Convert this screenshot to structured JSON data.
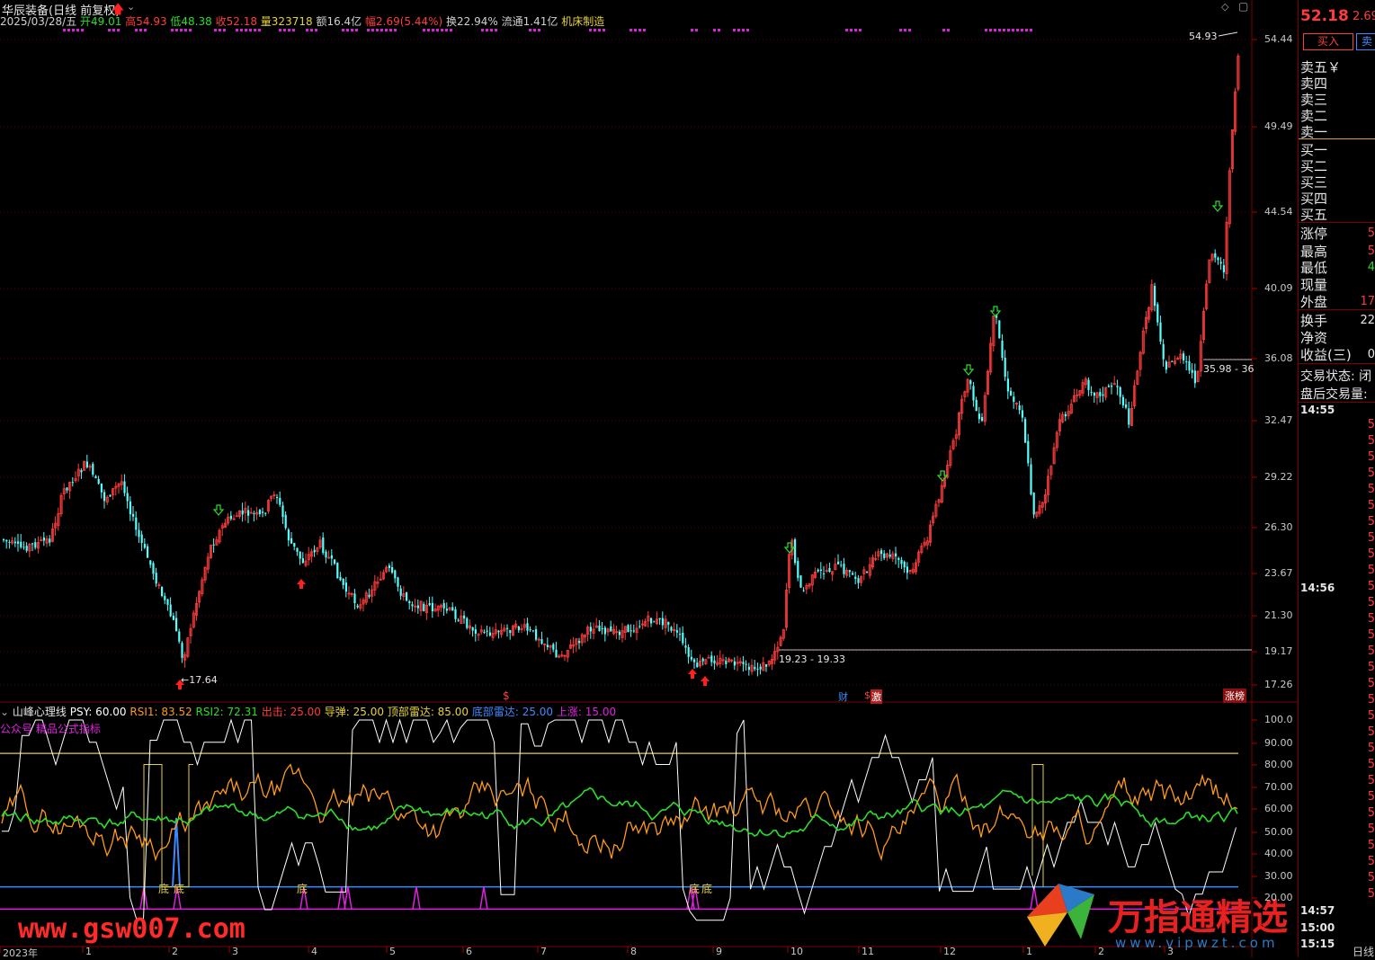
{
  "header": {
    "stock": "华辰装备(日线 前复权)",
    "date": "2025/03/28/五",
    "open": "开49.01",
    "high": "高54.93",
    "low": "低48.38",
    "close": "收52.18",
    "volume": "量323718",
    "amount": "额16.4亿",
    "change": "幅2.69(5.44%)",
    "turnover": "换22.94%",
    "float": "流通1.41亿",
    "industry": "机床制造"
  },
  "price_axis": [
    "54.44",
    "49.49",
    "44.54",
    "40.09",
    "36.08",
    "32.47",
    "29.22",
    "26.30",
    "23.67",
    "21.30",
    "19.17",
    "17.26"
  ],
  "indicator_axis": [
    "100.0",
    "90.00",
    "80.00",
    "70.00",
    "60.00",
    "50.00",
    "40.00",
    "30.00",
    "20.00"
  ],
  "annotations": {
    "high_label": "54.93",
    "low_label": "←17.64",
    "range1": "19.23 - 19.33",
    "range2": "35.98 - 36",
    "bottom_labels": [
      "底",
      "底",
      "底",
      "底",
      "底"
    ],
    "markers": {
      "cai": "财",
      "ji": "激",
      "dollar": "$",
      "zhangbang": "涨榜"
    }
  },
  "indicator": {
    "name": "山峰心理线",
    "psy": "PSY: 60.00",
    "rsi1": "RSI1: 83.52",
    "rsi2": "RSI2: 72.31",
    "chuji": "出击: 25.00",
    "daodan": "导弹: 25.00",
    "dingbu": "顶部雷达: 85.00",
    "dibu": "底部雷达: 25.00",
    "shangzhang": "上涨: 15.00",
    "note": "公众号 精品公式指标"
  },
  "time_axis": [
    "2023年",
    "1",
    "2",
    "3",
    "4",
    "5",
    "6",
    "7",
    "8",
    "9",
    "10",
    "11",
    "12",
    "1",
    "2",
    "3"
  ],
  "watermarks": {
    "left": "www.gsw007.com",
    "right": "万指通精选",
    "right_url": "www.vipwzt.com"
  },
  "right_panel": {
    "price": "52.18",
    "change": "2.69",
    "buy_btn": "买入",
    "sell_btn": "卖",
    "sells": [
      "卖五￥",
      "卖四",
      "卖三",
      "卖二",
      "卖一"
    ],
    "buys": [
      "买一",
      "买二",
      "买三",
      "买四",
      "买五"
    ],
    "stats": [
      "涨停",
      "最高",
      "最低",
      "现量",
      "外盘"
    ],
    "stats_vals": [
      "5",
      "5",
      "4",
      "",
      "17"
    ],
    "stats2": [
      "换手",
      "净资",
      "收益(三)"
    ],
    "stats2_vals": [
      "22",
      "",
      "0"
    ],
    "trade_status": "交易状态: 闭",
    "after_volume": "盘后交易量:",
    "times": [
      "14:55",
      "14:56",
      "14:57",
      "15:00",
      "15:15"
    ],
    "tick_digit": "5",
    "footer": "日线"
  },
  "colors": {
    "up": "#ff3c3c",
    "down": "#54ffff",
    "psy": "#ffffff",
    "rsi1": "#ff9a1a",
    "rsi2": "#2bdd2b",
    "top_line": "#e6d23c",
    "bottom_line": "#3c8cff",
    "magenta": "#e020e0"
  }
}
